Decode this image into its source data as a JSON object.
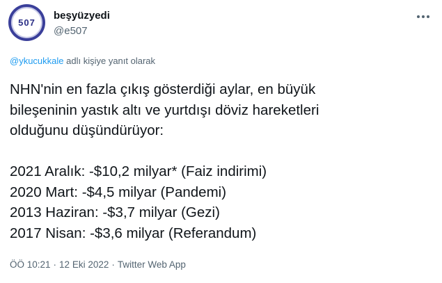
{
  "author": {
    "display_name": "beşyüzyedi",
    "handle": "@e507",
    "avatar_text": "507"
  },
  "reply": {
    "user": "@ykucukkale",
    "suffix": "adlı kişiye yanıt olarak"
  },
  "tweet": {
    "intro_lines": [
      "NHN'nin en fazla çıkış gösterdiği aylar, en büyük",
      "bileşeninin yastık altı ve yurtdışı döviz hareketleri",
      "olduğunu düşündürüyor:"
    ],
    "list_lines": [
      "2021 Aralık: -$10,2 milyar* (Faiz indirimi)",
      "2020 Mart: -$4,5 milyar (Pandemi)",
      "2013 Haziran: -$3,7 milyar (Gezi)",
      "2017 Nisan: -$3,6 milyar (Referandum)"
    ]
  },
  "meta": {
    "time": "ÖÖ 10:21",
    "separator": "·",
    "date": "12 Eki 2022",
    "source": "Twitter Web App"
  },
  "icons": {
    "more": "more-horizontal-icon"
  },
  "colors": {
    "link": "#1d9bf0",
    "secondary_text": "#536471",
    "primary_text": "#0f1419"
  }
}
